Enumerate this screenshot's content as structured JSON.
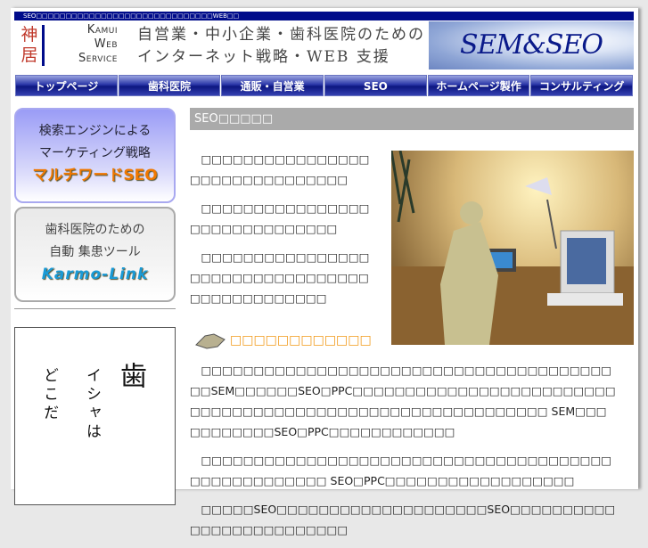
{
  "topbar": {
    "text": "SEO□□□□□□□□□□□□□□□□□□□□□□□□□□□□□□WEB□□"
  },
  "header": {
    "logo_kanji": "神居",
    "logo_lines": [
      "Kamui",
      "Web",
      "Service"
    ],
    "tagline": [
      "自営業・中小企業・歯科医院のための",
      "インターネット戦略・WEB 支援"
    ],
    "brand_graphic": "SEM&SEO"
  },
  "nav": [
    "トップページ",
    "歯科医院",
    "通販・自営業",
    "SEO",
    "ホームページ製作",
    "コンサルティング"
  ],
  "sidebar": {
    "banner1": {
      "lines": [
        "検索エンジンによる",
        "マーケティング戦略"
      ],
      "strong": "マルチワードSEO"
    },
    "banner2": {
      "lines": [
        "歯科医院のための",
        "自動 集患ツール"
      ],
      "strong": "Karmo-Link"
    },
    "vertical": [
      "歯",
      "イシャは",
      "どこだ"
    ]
  },
  "main": {
    "heading": "SEO□□□□□",
    "intro": [
      "□□□□□□□□□□□□□□□□□□□□□□□□□□□□□□□",
      "□□□□□□□□□□□□□□□□□□□□□□□□□□□□□□",
      "□□□□□□□□□□□□□□□□□□□□□□□□□□□□□□□□□□□□□□□□□□□□□□"
    ],
    "subheading": "□□□□□□□□□□□□",
    "body": [
      "□□□□□□□□□□□□□□□□□□□□□□□□□□□□□□□□□□□□□□□□□SEM□□□□□□SEO□PPC□□□□□□□□□□□□□□□□□□□□□□□□□□□□□□□□□□□□□□□□□□□□□□□□□□□□□□□□□□□ SEM□□□□□□□□□□□SEO□PPC□□□□□□□□□□□□",
      "□□□□□□□□□□□□□□□□□□□□□□□□□□□□□□□□□□□□□□□□□□□□□□□□□□□□ SEO□PPC□□□□□□□□□□□□□□□□□□",
      "□□□□□SEO□□□□□□□□□□□□□□□□□□□□SEO□□□□□□□□□□□□□□□□□□□□□□□□□"
    ]
  }
}
